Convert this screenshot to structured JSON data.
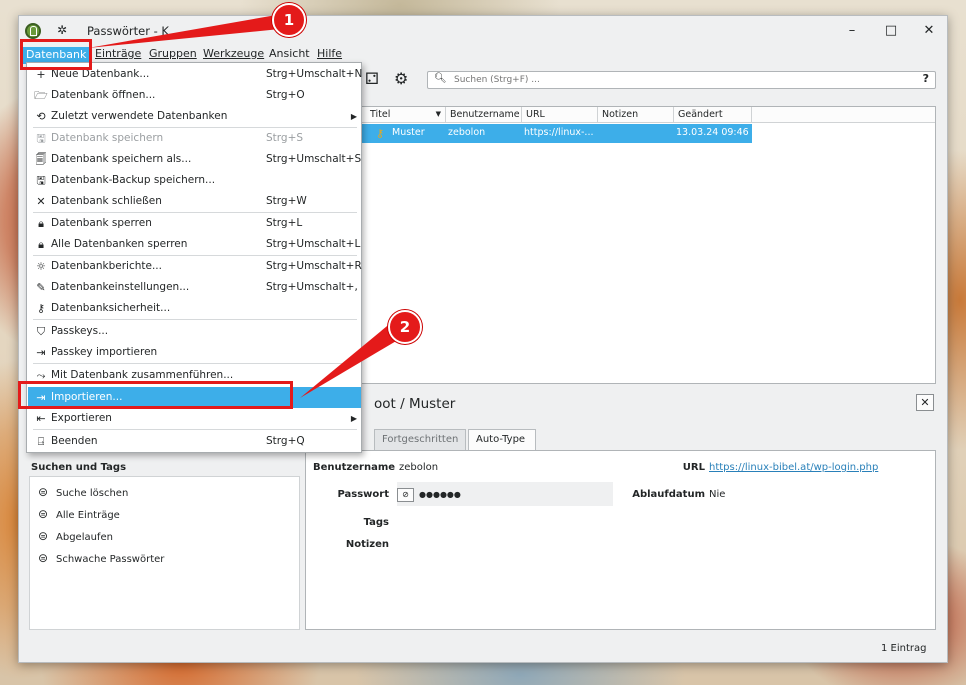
{
  "window": {
    "title": "Passwörter - K",
    "minimize": "–",
    "maximize": "□",
    "close": "✕"
  },
  "menubar": [
    "Datenbank",
    "Einträge",
    "Gruppen",
    "Werkzeuge",
    "Ansicht",
    "Hilfe"
  ],
  "search": {
    "placeholder": "Suchen (Strg+F) ...",
    "help": "?"
  },
  "columns": [
    "Titel",
    "Benutzername",
    "URL",
    "Notizen",
    "Geändert"
  ],
  "entry": {
    "title": "Muster",
    "username": "zebolon",
    "url": "https://linux-...",
    "notes": "",
    "changed": "13.03.24 09:46"
  },
  "detail": {
    "title": "oot / Muster",
    "close": "✕",
    "tabs": [
      "Fortgeschritten",
      "Auto-Type"
    ],
    "username_label": "Benutzername",
    "username": "zebolon",
    "password_label": "Passwort",
    "password": "●●●●●●",
    "tags_label": "Tags",
    "notes_label": "Notizen",
    "url_label": "URL",
    "url": "https://linux-bibel.at/wp-login.php",
    "expiry_label": "Ablaufdatum",
    "expiry": "Nie"
  },
  "sidebar": {
    "header": "Suchen und Tags",
    "items": [
      "Suche löschen",
      "Alle Einträge",
      "Abgelaufen",
      "Schwache Passwörter"
    ]
  },
  "status": "1 Eintrag",
  "menu": {
    "items": [
      {
        "label": "Neue Datenbank...",
        "shortcut": "Strg+Umschalt+N"
      },
      {
        "label": "Datenbank öffnen...",
        "shortcut": "Strg+O"
      },
      {
        "label": "Zuletzt verwendete Datenbanken",
        "shortcut": "",
        "arrow": "▶"
      },
      {
        "label": "Datenbank speichern",
        "shortcut": "Strg+S"
      },
      {
        "label": "Datenbank speichern als...",
        "shortcut": "Strg+Umschalt+S"
      },
      {
        "label": "Datenbank-Backup speichern...",
        "shortcut": ""
      },
      {
        "label": "Datenbank schließen",
        "shortcut": "Strg+W"
      },
      {
        "label": "Datenbank sperren",
        "shortcut": "Strg+L"
      },
      {
        "label": "Alle Datenbanken sperren",
        "shortcut": "Strg+Umschalt+L"
      },
      {
        "label": "Datenbankberichte...",
        "shortcut": "Strg+Umschalt+R"
      },
      {
        "label": "Datenbankeinstellungen...",
        "shortcut": "Strg+Umschalt+,"
      },
      {
        "label": "Datenbanksicherheit...",
        "shortcut": ""
      },
      {
        "label": "Passkeys...",
        "shortcut": ""
      },
      {
        "label": "Passkey importieren",
        "shortcut": ""
      },
      {
        "label": "Mit Datenbank zusammenführen...",
        "shortcut": ""
      },
      {
        "label": "Importieren...",
        "shortcut": ""
      },
      {
        "label": "Exportieren",
        "shortcut": "",
        "arrow": "▶"
      },
      {
        "label": "Beenden",
        "shortcut": "Strg+Q"
      }
    ]
  },
  "annotations": [
    "1",
    "2"
  ],
  "colors": {
    "accent": "#3daee9",
    "highlight_red": "#e41a1a"
  }
}
